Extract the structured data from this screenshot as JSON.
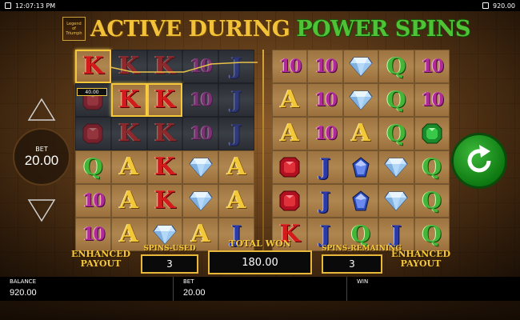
{
  "status_bar": {
    "time": "12:07:13 PM",
    "balance": "920.00"
  },
  "title": {
    "logo_text": "Legend of Triumph",
    "part1": "ACTIVE DURING",
    "part2": "POWER SPINS"
  },
  "reels": {
    "left": [
      [
        "K",
        "K",
        "K",
        "10",
        "J"
      ],
      [
        "ruby",
        "K",
        "K",
        "10",
        "J"
      ],
      [
        "ruby",
        "K",
        "K",
        "10",
        "J"
      ],
      [
        "Q",
        "A",
        "K",
        "diamond",
        "A"
      ],
      [
        "10",
        "A",
        "K",
        "diamond",
        "A"
      ],
      [
        "10",
        "A",
        "diamond",
        "A",
        "J"
      ]
    ],
    "right": [
      [
        "10",
        "10",
        "diamond",
        "Q",
        "10"
      ],
      [
        "A",
        "10",
        "diamond",
        "Q",
        "10"
      ],
      [
        "A",
        "10",
        "A",
        "Q",
        "emerald"
      ],
      [
        "ruby",
        "J",
        "sapphire",
        "diamond",
        "Q"
      ],
      [
        "ruby",
        "J",
        "sapphire",
        "diamond",
        "Q"
      ],
      [
        "K",
        "J",
        "Q",
        "J",
        "Q"
      ]
    ],
    "left_dim": [
      [
        0,
        1,
        1,
        1,
        1
      ],
      [
        1,
        0,
        0,
        1,
        1
      ],
      [
        1,
        1,
        1,
        1,
        1
      ],
      [
        0,
        0,
        0,
        0,
        0
      ],
      [
        0,
        0,
        0,
        0,
        0
      ],
      [
        0,
        0,
        0,
        0,
        0
      ]
    ],
    "left_win": [
      [
        1,
        0,
        0,
        0,
        0
      ],
      [
        0,
        1,
        1,
        0,
        0
      ],
      [
        0,
        0,
        0,
        0,
        0
      ],
      [
        0,
        0,
        0,
        0,
        0
      ],
      [
        0,
        0,
        0,
        0,
        0
      ],
      [
        0,
        0,
        0,
        0,
        0
      ]
    ],
    "win_label": "40.00"
  },
  "bet": {
    "label": "BET",
    "value": "20.00"
  },
  "bottom_labels": {
    "enhanced_left": "ENHANCED PAYOUT",
    "enhanced_right": "ENHANCED PAYOUT",
    "spins_used_label": "SPINS-USED",
    "spins_used_value": "3",
    "total_won_label": "TOTAL WON",
    "total_won_value": "180.00",
    "spins_remaining_label": "SPINS-REMAINING",
    "spins_remaining_value": "3"
  },
  "footer": {
    "balance_label": "BALANCE",
    "balance_value": "920.00",
    "bet_label": "BET",
    "bet_value": "20.00",
    "win_label": "WIN",
    "win_value": ""
  },
  "colors": {
    "gold": "#f2c73a",
    "green": "#45b53a",
    "spin_green": "#0e7a12"
  }
}
